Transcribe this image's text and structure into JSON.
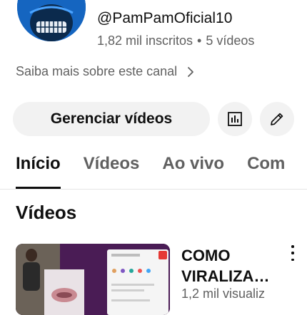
{
  "channel": {
    "handle": "@PamPamOficial10",
    "subscribers": "1,82 mil inscritos",
    "separator": "•",
    "videos_count": "5 vídeos",
    "about_link": "Saiba mais sobre este canal",
    "avatar_color": "#1565c0"
  },
  "actions": {
    "manage_label": "Gerenciar vídeos",
    "analytics_icon": "bar-chart-icon",
    "edit_icon": "pencil-icon"
  },
  "tabs": [
    {
      "label": "Início",
      "active": true
    },
    {
      "label": "Vídeos",
      "active": false
    },
    {
      "label": "Ao vivo",
      "active": false
    },
    {
      "label": "Com",
      "active": false
    }
  ],
  "section": {
    "title": "Vídeos"
  },
  "videos": [
    {
      "title_line1": "COMO",
      "title_line2": "VIRALIZA…",
      "views": "1,2 mil visualiz"
    }
  ]
}
